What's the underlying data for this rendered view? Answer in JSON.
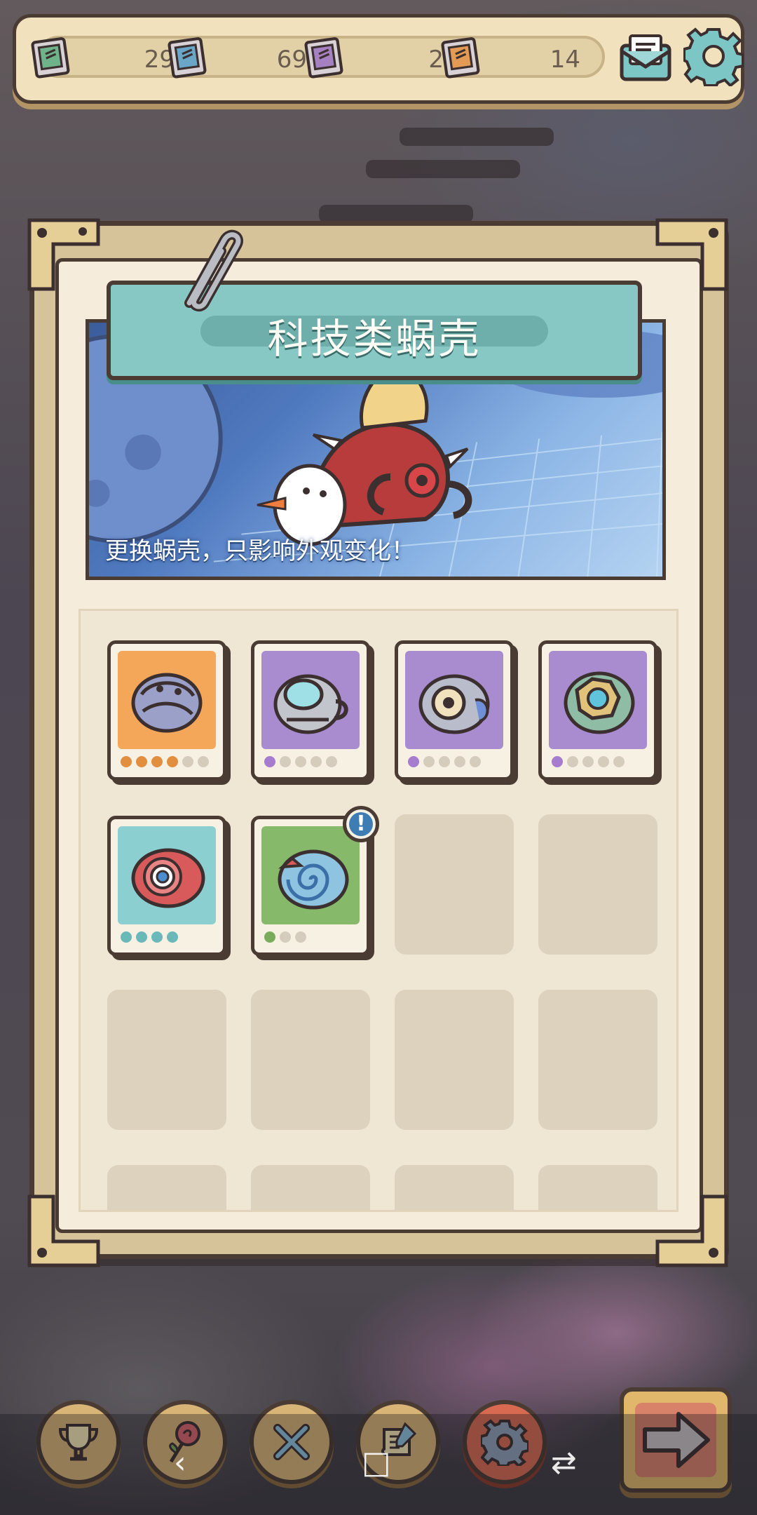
{
  "currency_bar": {
    "items": [
      {
        "icon": "green-tech-book-icon",
        "value": "29",
        "color": "#6fb38a"
      },
      {
        "icon": "blue-tech-book-icon",
        "value": "69",
        "color": "#6aa6c8"
      },
      {
        "icon": "purple-tech-book-icon",
        "value": "2",
        "color": "#a681c1"
      },
      {
        "icon": "orange-tech-book-icon",
        "value": "14",
        "color": "#e29a55"
      }
    ],
    "mail_icon": "mail-icon",
    "settings_icon": "gear-icon"
  },
  "panel": {
    "title": "科技类蜗壳",
    "subtitle": "更换蜗壳，只影响外观变化！"
  },
  "shells": [
    {
      "name": "armored-shell",
      "bg": "#f5a759",
      "rarity_color": "#e18e3e",
      "filled": 4,
      "total": 6
    },
    {
      "name": "diving-helmet-shell",
      "bg": "#a98ccf",
      "rarity_color": "#a67ccf",
      "filled": 1,
      "total": 5
    },
    {
      "name": "gear-shell",
      "bg": "#a98ccf",
      "rarity_color": "#a67ccf",
      "filled": 1,
      "total": 5
    },
    {
      "name": "crystal-core-shell",
      "bg": "#a98ccf",
      "rarity_color": "#a67ccf",
      "filled": 1,
      "total": 5
    },
    {
      "name": "target-shell",
      "bg": "#8ccfd0",
      "rarity_color": "#6ab8ba",
      "filled": 4,
      "total": 4
    },
    {
      "name": "swirl-shell",
      "bg": "#86b96a",
      "rarity_color": "#79ad5c",
      "filled": 1,
      "total": 3,
      "badge": "!"
    }
  ],
  "empty_slots": 10,
  "nav": [
    {
      "name": "trophy-icon"
    },
    {
      "name": "rose-icon"
    },
    {
      "name": "tools-icon"
    },
    {
      "name": "scroll-icon"
    },
    {
      "name": "gear-icon",
      "active": true
    }
  ],
  "next_button_icon": "arrow-right-icon",
  "system_nav": {
    "back": "‹",
    "home": "□",
    "recents": "⇄"
  }
}
